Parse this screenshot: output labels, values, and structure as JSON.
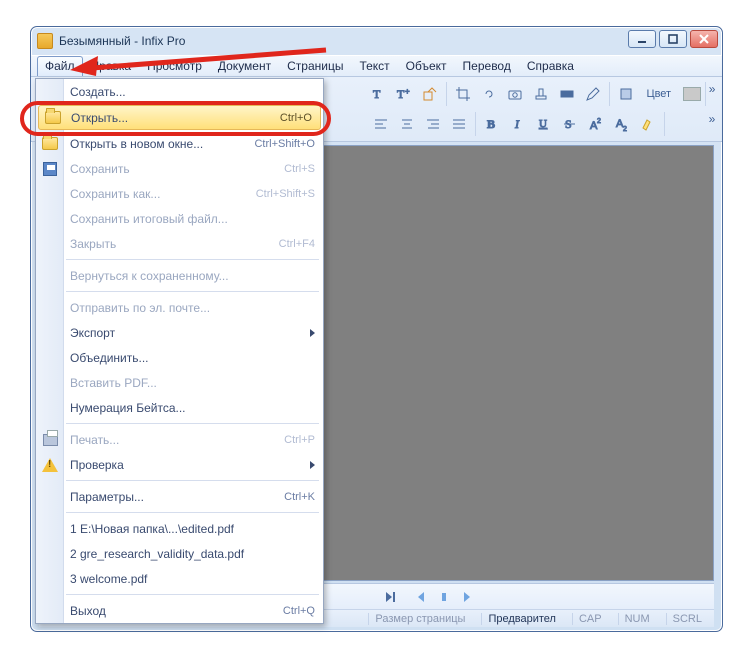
{
  "window_title": "Безымянный - Infix Pro",
  "menubar": [
    "Файл",
    "Правка",
    "Просмотр",
    "Документ",
    "Страницы",
    "Текст",
    "Объект",
    "Перевод",
    "Справка"
  ],
  "toolbar2": {
    "color_label": "Цвет"
  },
  "dropdown": {
    "create": {
      "label": "Создать..."
    },
    "open": {
      "label": "Открыть...",
      "shortcut": "Ctrl+O"
    },
    "open_new": {
      "label": "Открыть в новом окне...",
      "shortcut": "Ctrl+Shift+O"
    },
    "save": {
      "label": "Сохранить",
      "shortcut": "Ctrl+S"
    },
    "save_as": {
      "label": "Сохранить как...",
      "shortcut": "Ctrl+Shift+S"
    },
    "save_final": {
      "label": "Сохранить итоговый файл..."
    },
    "close": {
      "label": "Закрыть",
      "shortcut": "Ctrl+F4"
    },
    "revert": {
      "label": "Вернуться к сохраненному..."
    },
    "send_mail": {
      "label": "Отправить по эл. почте..."
    },
    "export": {
      "label": "Экспорт"
    },
    "merge": {
      "label": "Объединить..."
    },
    "insert_pdf": {
      "label": "Вставить PDF..."
    },
    "bates": {
      "label": "Нумерация Бейтса..."
    },
    "print": {
      "label": "Печать...",
      "shortcut": "Ctrl+P"
    },
    "check": {
      "label": "Проверка"
    },
    "params": {
      "label": "Параметры...",
      "shortcut": "Ctrl+K"
    },
    "recent1": {
      "label": "1 E:\\Новая папка\\...\\edited.pdf"
    },
    "recent2": {
      "label": "2 gre_research_validity_data.pdf"
    },
    "recent3": {
      "label": "3 welcome.pdf"
    },
    "exit": {
      "label": "Выход",
      "shortcut": "Ctrl+Q"
    }
  },
  "status": {
    "page_size": "Размер страницы",
    "preview": "Предварител",
    "cap": "CAP",
    "num": "NUM",
    "scrl": "SCRL"
  }
}
